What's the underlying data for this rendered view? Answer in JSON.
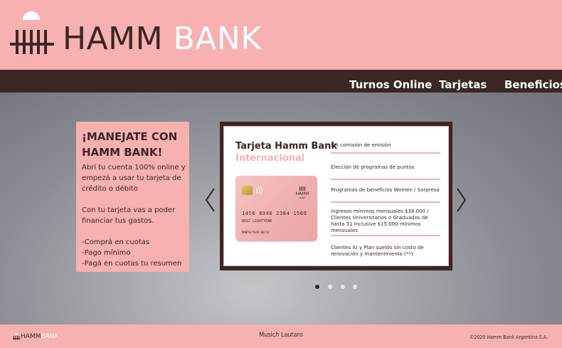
{
  "header": {
    "brand_part1": "HAMM",
    "brand_part2": "BANK"
  },
  "nav": {
    "items": [
      {
        "label": "Turnos Online"
      },
      {
        "label": "Tarjetas"
      },
      {
        "label": "Beneficios"
      }
    ]
  },
  "promo": {
    "title": "¡MANEJATE CON HAMM BANK!",
    "text": "Abrí tu cuenta 100% online y empezá a usar tu tarjeta de crédito o débito\n\nCon tu tarjeta vas a poder financiar tus gastos.\n\n-Comprá en cuotas\n-Pago mínimo\n-Pagá en cuotas tu resumen"
  },
  "slide": {
    "title": "Tarjeta Hamm Bank",
    "subtitle": "Internacional",
    "card": {
      "logo_text": "HAMM",
      "logo_sub": "BANK",
      "number": "1456 8946 2384 1569",
      "holder": "BUZZ LIGHTYEAR",
      "valid": "MONTH/YEAR 06/24"
    },
    "benefits": [
      "Sin comisión de emisión",
      "Elección de programas de puntos",
      "Programas de beneficios Women / Sorpresa",
      "Ingresos mínimos mensuales $38.000 / Clientes Universitarios o Graduados de hasta 31 inclusive $15.000 mínimos mensuales",
      "Clientes IU y Plan sueldo sin costo de renovación y mantenimiento (**)"
    ]
  },
  "carousel": {
    "active_index": 0,
    "count": 4
  },
  "footer": {
    "logo_part1": "HAMM",
    "logo_part2": "BANK",
    "author": "Musich Lautaro",
    "copyright": "©2020 Hamm Bank Argentina S.A."
  },
  "colors": {
    "pink": "#f6b1b0",
    "dark_brown": "#3a2624",
    "white": "#ffffff"
  },
  "icons": {
    "logo_mark": "bank-columns-icon",
    "prev": "chevron-left-icon",
    "next": "chevron-right-icon"
  }
}
